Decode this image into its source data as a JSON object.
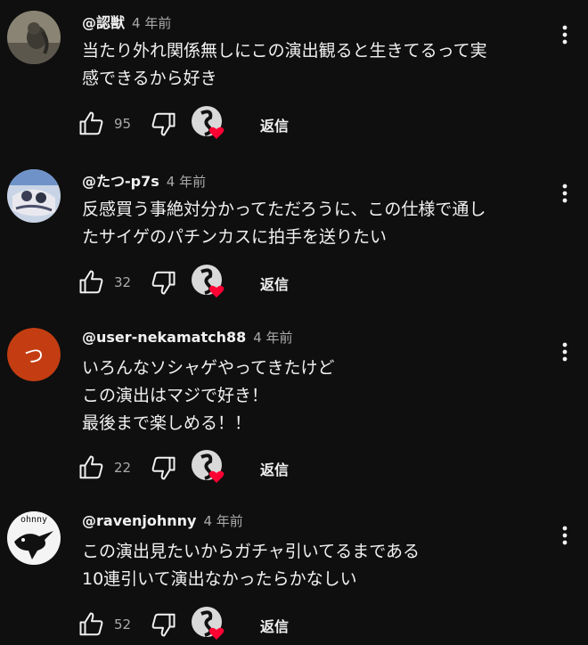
{
  "comments": [
    {
      "author": "@認獣",
      "time": "4 年前",
      "lines": [
        "当たり外れ関係無しにこの演出観ると生きてるって実",
        "感できるから好き"
      ],
      "likes": "95",
      "reply_label": "返信"
    },
    {
      "author": "@たつ-p7s",
      "time": "4 年前",
      "lines": [
        "反感買う事絶対分かってただろうに、この仕様で通し",
        "たサイゲのパチンカスに拍手を送りたい"
      ],
      "likes": "32",
      "reply_label": "返信"
    },
    {
      "author": "@user-nekamatch88",
      "time": "4 年前",
      "avatar_letter": "つ",
      "lines": [
        "いろんなソシャゲやってきたけど",
        "この演出はマジで好き！",
        "最後まで楽しめる！！"
      ],
      "likes": "22",
      "reply_label": "返信"
    },
    {
      "author": "@ravenjohnny",
      "time": "4 年前",
      "lines": [
        "この演出見たいからガチャ引いてるまである",
        "10連引いて演出なかったらかなしい"
      ],
      "likes": "52",
      "reply_label": "返信"
    }
  ],
  "colors": {
    "background": "#0f0f0f",
    "text": "#f1f1f1",
    "secondary_text": "#aaaaaa",
    "heart": "#ff0033",
    "avatar_orange": "#c43d12"
  },
  "icons": [
    "thumbs-up-icon",
    "thumbs-down-icon",
    "creator-heart-icon",
    "more-vert-icon"
  ]
}
